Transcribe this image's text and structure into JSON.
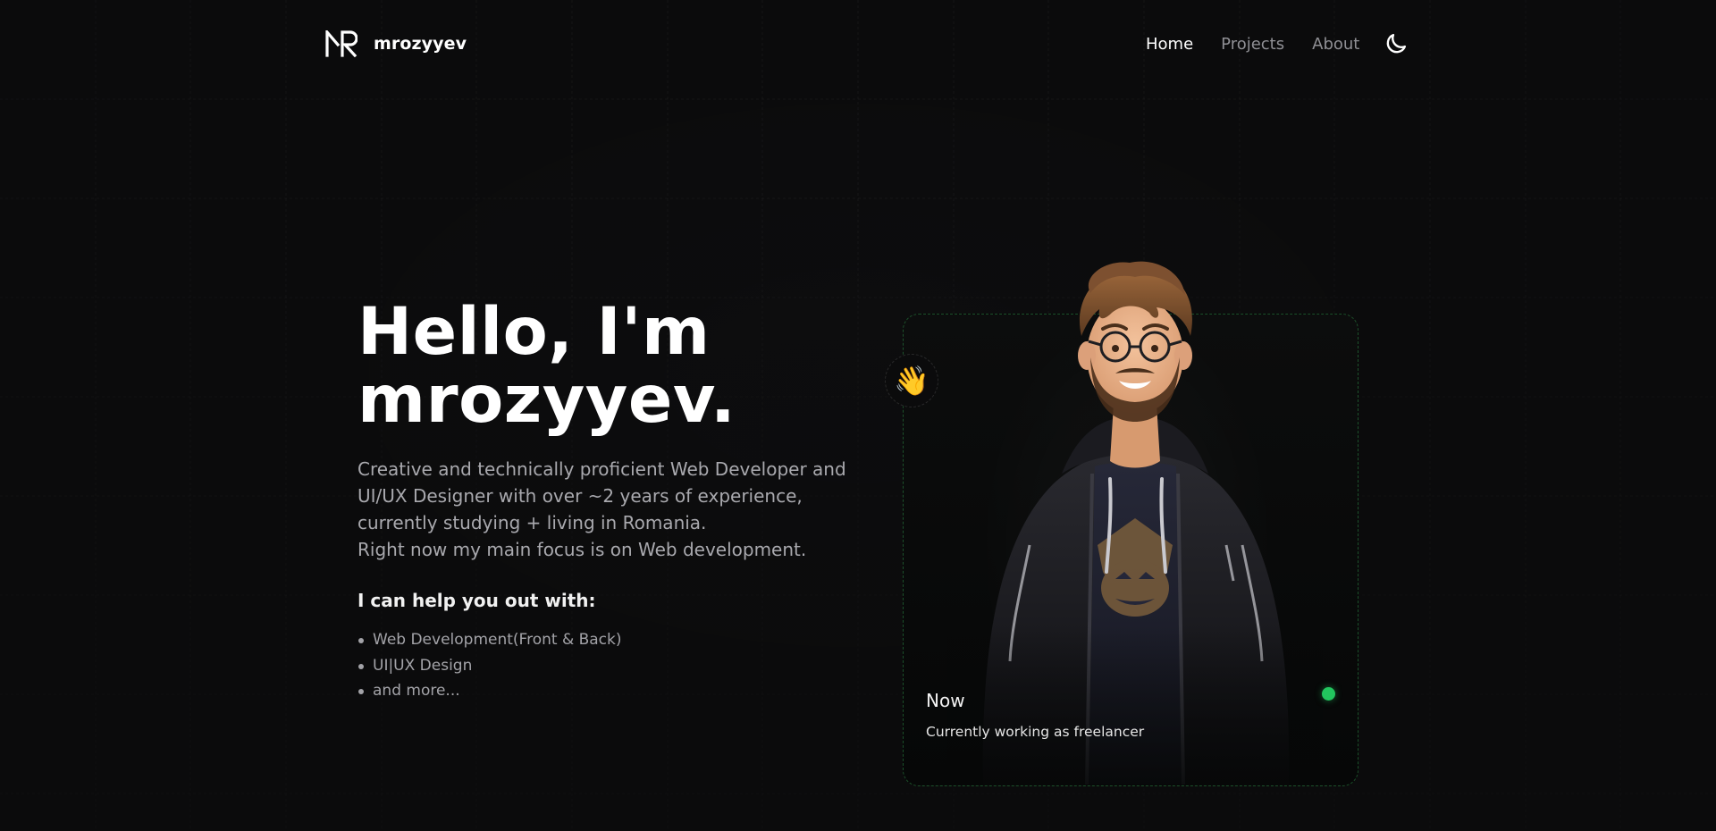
{
  "header": {
    "brand_name": "mrozyyev",
    "logo_icon": "mr-monogram-logo",
    "nav": [
      {
        "label": "Home",
        "active": true
      },
      {
        "label": "Projects",
        "active": false
      },
      {
        "label": "About",
        "active": false
      }
    ],
    "theme_toggle_icon": "moon-icon"
  },
  "hero": {
    "title_line1": "Hello, I'm",
    "title_line2": "mrozyyev.",
    "description_1": "Creative and technically proficient Web Developer and UI/UX Designer with over ~2 years of experience, currently studying + living in Romania.",
    "description_2": "Right now my main focus is on Web development.",
    "help_title": "I can help you out with:",
    "help_items": [
      "Web Development(Front & Back)",
      "UI|UX Design",
      "and more..."
    ]
  },
  "card": {
    "wave_emoji": "👋",
    "status_title": "Now",
    "status_subtitle": "Currently working as freelancer",
    "status_dot_color": "#22c55e",
    "avatar": "cartoon-developer-avatar"
  },
  "colors": {
    "background": "#0b0b0c",
    "accent_green": "#22c55e",
    "text_muted": "#a9a9ae"
  }
}
